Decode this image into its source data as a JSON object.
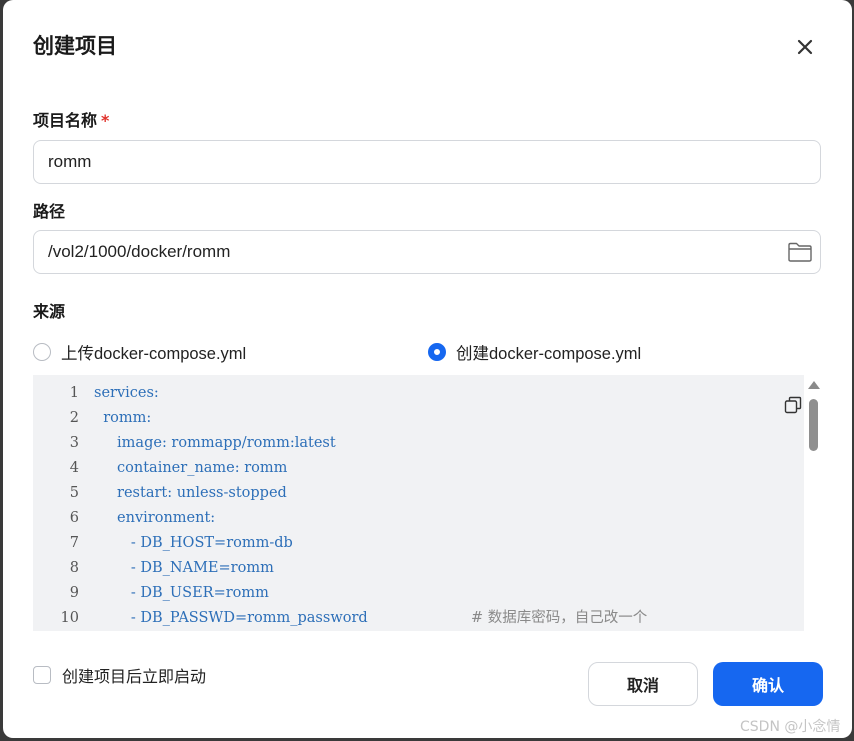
{
  "dialog": {
    "title": "创建项目",
    "close_icon": "close-icon"
  },
  "project_name": {
    "label": "项目名称",
    "required_mark": "*",
    "value": "romm"
  },
  "path": {
    "label": "路径",
    "value": "/vol2/1000/docker/romm",
    "icon": "folder-icon"
  },
  "source": {
    "label": "来源",
    "options": [
      {
        "label": "上传docker-compose.yml",
        "selected": false
      },
      {
        "label": "创建docker-compose.yml",
        "selected": true
      }
    ]
  },
  "editor": {
    "copy_icon": "copy-icon",
    "lines": [
      {
        "num": "1",
        "code": "services:",
        "comment": ""
      },
      {
        "num": "2",
        "code": "  romm:",
        "comment": ""
      },
      {
        "num": "3",
        "code": "     image: rommapp/romm:latest",
        "comment": ""
      },
      {
        "num": "4",
        "code": "     container_name: romm",
        "comment": ""
      },
      {
        "num": "5",
        "code": "     restart: unless-stopped",
        "comment": ""
      },
      {
        "num": "6",
        "code": "     environment:",
        "comment": ""
      },
      {
        "num": "7",
        "code": "        - DB_HOST=romm-db",
        "comment": ""
      },
      {
        "num": "8",
        "code": "        - DB_NAME=romm",
        "comment": ""
      },
      {
        "num": "9",
        "code": "        - DB_USER=romm",
        "comment": ""
      },
      {
        "num": "10",
        "code": "        - DB_PASSWD=romm_password",
        "comment": "# 数据库密码，自己改一个"
      }
    ]
  },
  "footer": {
    "autostart_label": "创建项目后立即启动",
    "cancel_label": "取消",
    "confirm_label": "确认"
  },
  "watermark": "CSDN @小念情",
  "colors": {
    "primary": "#1667f0",
    "required": "#e0312a",
    "code": "#2d6fb8",
    "editor_bg": "#f1f2f4"
  }
}
